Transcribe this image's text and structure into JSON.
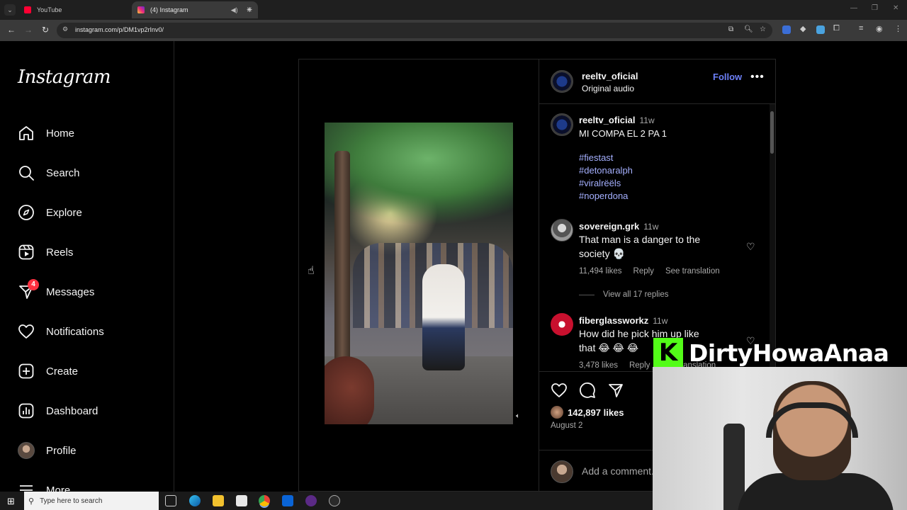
{
  "browser": {
    "tabs": [
      {
        "title": "YouTube",
        "favicon_color": "#ff0033"
      },
      {
        "title": "(4) Instagram",
        "favicon_color": "#d6249f"
      }
    ],
    "url": "instagram.com/p/DM1vp2rInv0/"
  },
  "sidebar": {
    "logo": "Instagram",
    "items": [
      {
        "label": "Home",
        "icon": "home-icon"
      },
      {
        "label": "Search",
        "icon": "search-icon"
      },
      {
        "label": "Explore",
        "icon": "compass-icon"
      },
      {
        "label": "Reels",
        "icon": "reels-icon"
      },
      {
        "label": "Messages",
        "icon": "messenger-icon",
        "badge": "4"
      },
      {
        "label": "Notifications",
        "icon": "heart-icon"
      },
      {
        "label": "Create",
        "icon": "plus-square-icon"
      },
      {
        "label": "Dashboard",
        "icon": "dashboard-icon"
      },
      {
        "label": "Profile",
        "icon": "avatar"
      },
      {
        "label": "More",
        "icon": "menu-icon"
      }
    ]
  },
  "post": {
    "header": {
      "username": "reeltv_oficial",
      "audio": "Original audio",
      "follow_label": "Follow"
    },
    "caption": {
      "username": "reeltv_oficial",
      "time": "11w",
      "text": "MI COMPA EL 2 PA 1",
      "hashtags": [
        "#fiestast",
        "#detonaralph",
        "#viralrëëls",
        "#noperdona"
      ]
    },
    "comments": [
      {
        "username": "sovereign.grk",
        "time": "11w",
        "text_line1": "That man is a danger to the",
        "text_line2": "society 💀",
        "likes": "11,494 likes",
        "reply": "Reply",
        "translate": "See translation",
        "view_replies": "View all 17 replies"
      },
      {
        "username": "fiberglassworkz",
        "time": "11w",
        "text_line1": "How did he pick him up like",
        "text_line2": "that 😂 😂 😂",
        "likes": "3,478 likes",
        "reply": "Reply",
        "translate": "See translation"
      }
    ],
    "likes_count": "142,897 likes",
    "date": "August 2",
    "add_comment_placeholder": "Add a comment..."
  },
  "overlay": {
    "kick_letter": "K",
    "channel_name": "DirtyHowaAnaa"
  },
  "taskbar": {
    "search_placeholder": "Type here to search"
  }
}
